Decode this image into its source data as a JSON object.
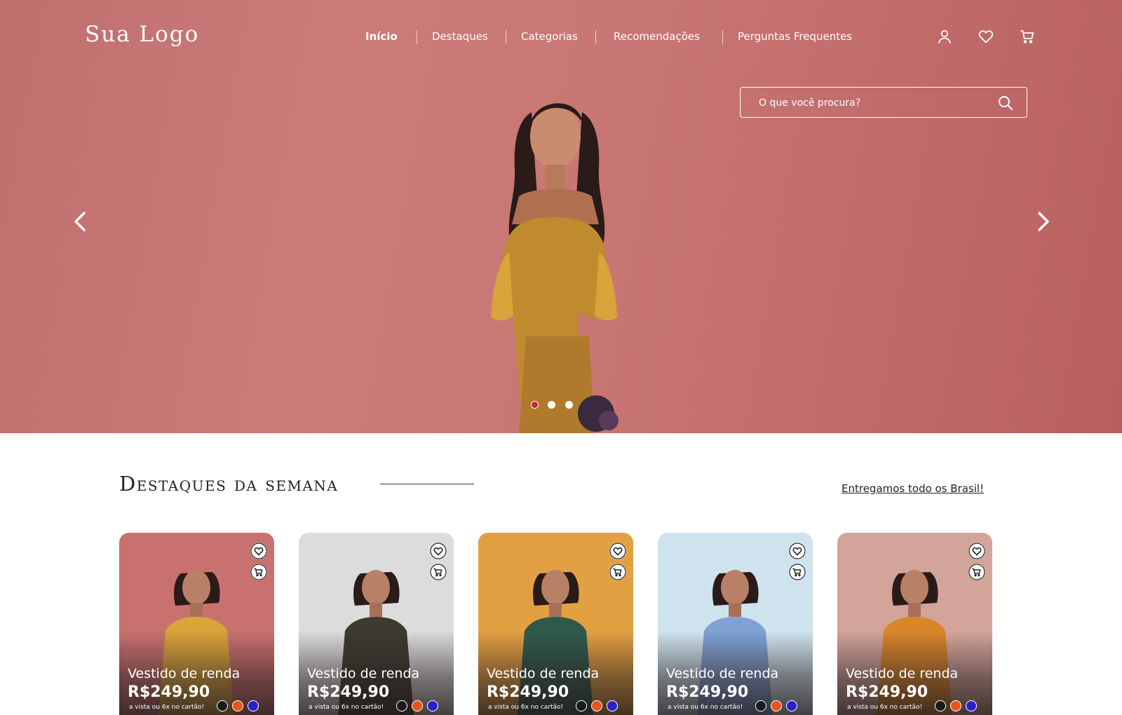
{
  "header": {
    "logo": "Sua Logo",
    "nav": [
      "Início",
      "Destaques",
      "Categorias",
      "Recomendações",
      "Perguntas Frequentes"
    ],
    "active_nav": "Início",
    "icons": [
      "user-icon",
      "heart-icon",
      "cart-icon"
    ]
  },
  "search": {
    "placeholder": "O que você procura?"
  },
  "hero": {
    "slides_count": 3,
    "active_slide": 1,
    "background": "#c87673",
    "active_dot_color": "#c8223a"
  },
  "section": {
    "title": "Destaques da semana",
    "shipping_link": "Entregamos todo os Brasil!"
  },
  "products": [
    {
      "name": "Vestido de renda",
      "price": "R$249,90",
      "terms": "a vista ou 6x no cartão!",
      "colors": [
        "#1a1a1a",
        "#e8541a",
        "#2a22c8"
      ],
      "bg": "#c9716f",
      "outfit": "#d9a43a"
    },
    {
      "name": "Vestido de renda",
      "price": "R$249,90",
      "terms": "a vista ou 6x no cartão!",
      "colors": [
        "#1a1a1a",
        "#e8541a",
        "#2a22c8"
      ],
      "bg": "#dcdcdc",
      "outfit": "#3d3a30"
    },
    {
      "name": "Vestido de renda",
      "price": "R$249,90",
      "terms": "a vista ou 6x no cartão!",
      "colors": [
        "#1a1a1a",
        "#e8541a",
        "#2a22c8"
      ],
      "bg": "#e3a043",
      "outfit": "#2f5a4a"
    },
    {
      "name": "Vestido de renda",
      "price": "R$249,90",
      "terms": "a vista ou 6x no cartão!",
      "colors": [
        "#1a1a1a",
        "#e8541a",
        "#2a22c8"
      ],
      "bg": "#cfe3ef",
      "outfit": "#7fa2d6"
    },
    {
      "name": "Vestido de renda",
      "price": "R$249,90",
      "terms": "a vista ou 6x no cartão!",
      "colors": [
        "#1a1a1a",
        "#e8541a",
        "#2a22c8"
      ],
      "bg": "#d3a49a",
      "outfit": "#d9862a"
    }
  ]
}
